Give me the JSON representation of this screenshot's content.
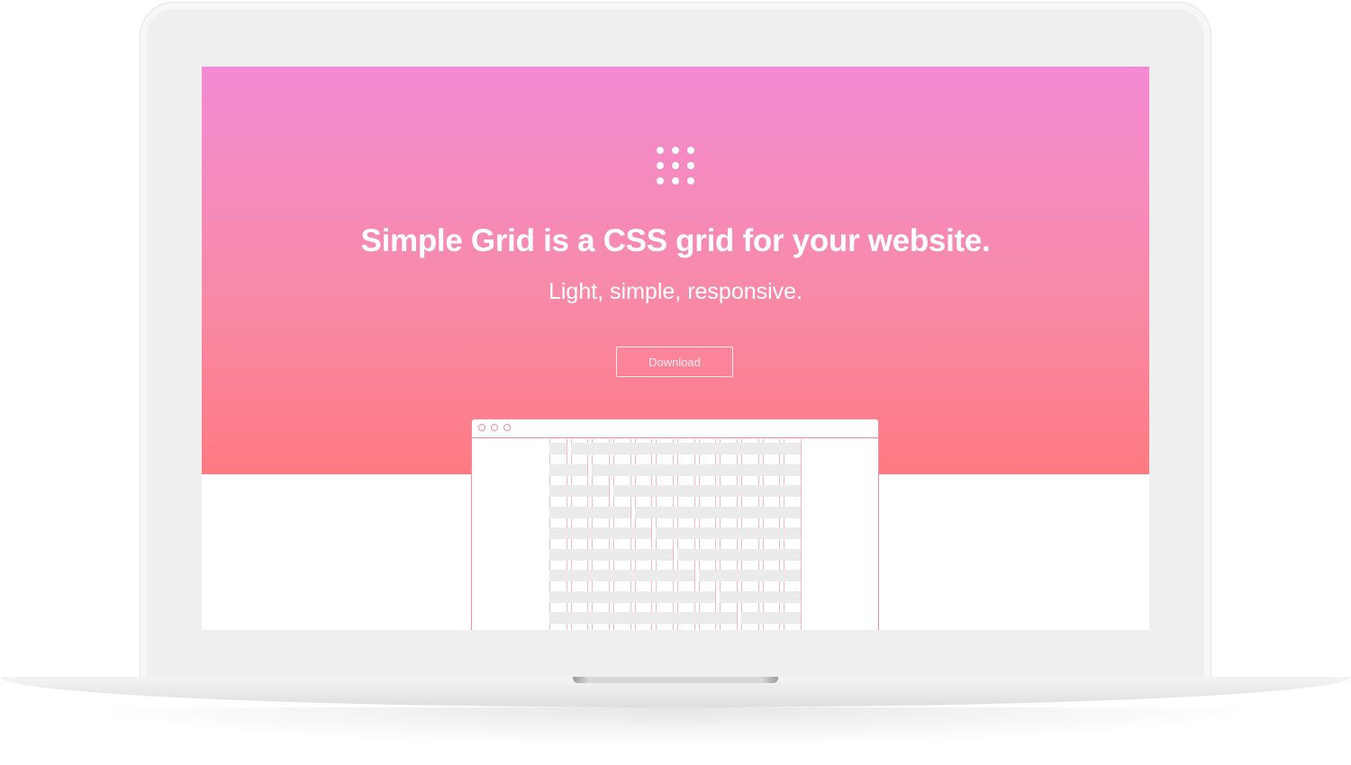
{
  "hero": {
    "headline": "Simple Grid is a CSS grid for your website.",
    "subline": "Light, simple, responsive.",
    "download_label": "Download",
    "logo_icon": "grid-dots-icon"
  },
  "colors": {
    "gradient_top": "#f38ad4",
    "gradient_bottom": "#ff7a82",
    "mini_border": "#f48a9e",
    "grid_cell": "#ebebeb",
    "grid_line": "#f7b7c4"
  },
  "mini_browser": {
    "window_dots": [
      "close-dot-icon",
      "minimize-dot-icon",
      "maximize-dot-icon"
    ]
  }
}
